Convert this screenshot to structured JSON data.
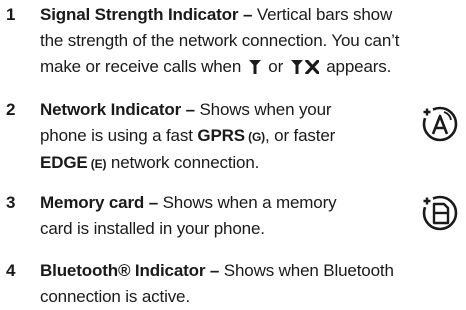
{
  "items": [
    {
      "number": "1",
      "title": "Signal Strength Indicator –",
      "line1_rest": " Vertical bars show",
      "line2": "the strength of the network connection. You can’t",
      "line3_pre": "make or receive calls when ",
      "line3_mid": " or ",
      "line3_post": " appears."
    },
    {
      "number": "2",
      "title": "Network Indicator –",
      "line1_rest": " Shows when your",
      "line2_pre": "phone is using a fast ",
      "line2_bold": "GPRS",
      "line2_small": " (G)",
      "line2_post": ", or faster",
      "line3_bold": "EDGE",
      "line3_small": " (E)",
      "line3_post": " network connection.",
      "icon": "network-indicator-icon"
    },
    {
      "number": "3",
      "title": "Memory card –",
      "line1_rest": " Shows when a memory",
      "line2": "card is installed in your phone.",
      "icon": "memory-card-icon"
    },
    {
      "number": "4",
      "title": "Bluetooth® Indicator –",
      "line1_rest": " Shows when Bluetooth",
      "line2": "connection is active."
    }
  ],
  "inline_icons": [
    "antenna-icon",
    "no-signal-icon"
  ]
}
